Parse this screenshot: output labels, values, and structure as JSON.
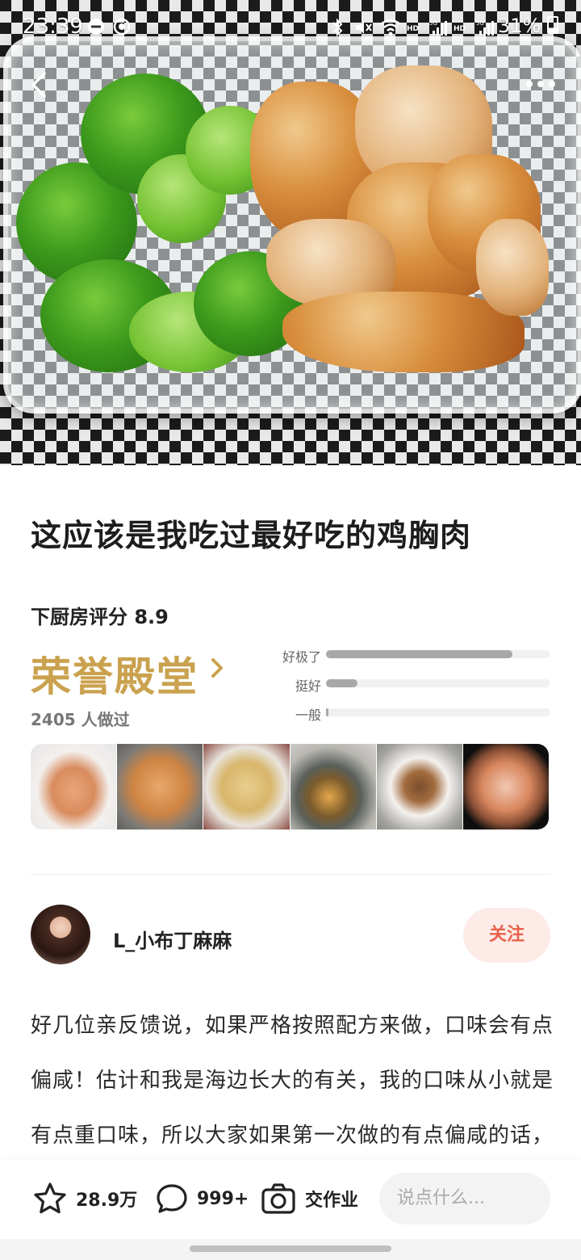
{
  "status_bar": {
    "time": "23:39",
    "battery": "31%",
    "icons": [
      "minus-circle-icon",
      "notification-icon",
      "bluetooth-icon",
      "mute-icon",
      "wifi-icon",
      "signal-icon",
      "signal-icon"
    ]
  },
  "header": {
    "back_icon": "back-arrow-icon",
    "more_icon": "more-dots-icon"
  },
  "recipe": {
    "title": "这应该是我吃过最好吃的鸡胸肉",
    "score_text": "下厨房评分 8.9",
    "rank_label": "荣誉殿堂",
    "made_count": "2405 人做过",
    "ratings": [
      {
        "label": "好极了",
        "fraction": 0.83
      },
      {
        "label": "挺好",
        "fraction": 0.14
      },
      {
        "label": "一般",
        "fraction": 0.01
      }
    ]
  },
  "author": {
    "name": "L_小布丁麻麻",
    "follow_label": "关注"
  },
  "description": "好几位亲反馈说，如果严格按照配方来做，口味会有点偏咸！估计和我是海边长大的有关，我的口味从小就是有点重口味，所以大家如果第一次做的有点偏咸的话，第二次做可以适当减少盐",
  "bottom_bar": {
    "star_count": "28.9万",
    "comment_count": "999+",
    "homework_label": "交作业",
    "comment_placeholder": "说点什么..."
  },
  "colors": {
    "rank_gold": "#caa24f",
    "follow_text": "#e8614b",
    "follow_bg": "#fdebe7"
  }
}
